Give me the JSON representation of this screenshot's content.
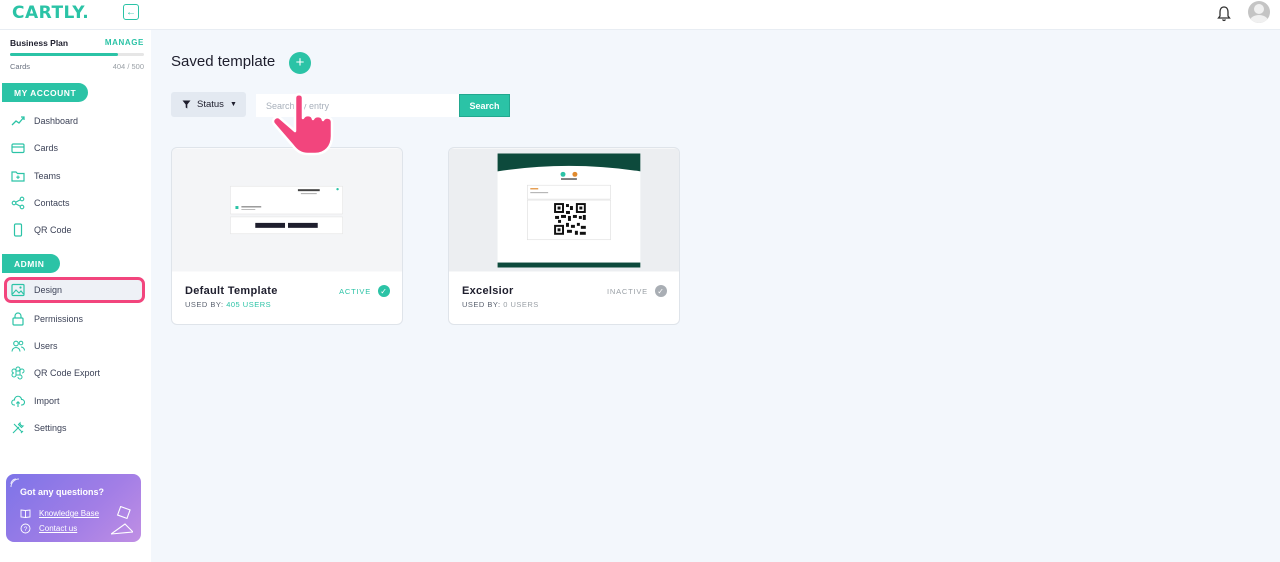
{
  "brand": {
    "logo_text": "CARTLY.",
    "accent": "#2bc3a6",
    "highlight": "#f2457d"
  },
  "plan": {
    "name": "Business Plan",
    "manage_label": "MANAGE",
    "cards_label": "Cards",
    "cards_count": "404 / 500",
    "usage_fraction": 0.808
  },
  "sidebar": {
    "my_account_label": "MY ACCOUNT",
    "admin_label": "ADMIN",
    "account_items": [
      {
        "label": "Dashboard",
        "icon": "trend-icon"
      },
      {
        "label": "Cards",
        "icon": "card-icon"
      },
      {
        "label": "Teams",
        "icon": "folder-icon"
      },
      {
        "label": "Contacts",
        "icon": "share-icon"
      },
      {
        "label": "QR Code",
        "icon": "phone-icon"
      }
    ],
    "admin_items": [
      {
        "label": "Design",
        "icon": "image-icon",
        "active": true
      },
      {
        "label": "Permissions",
        "icon": "lock-icon"
      },
      {
        "label": "Users",
        "icon": "users-icon"
      },
      {
        "label": "QR Code Export",
        "icon": "command-icon"
      },
      {
        "label": "Import",
        "icon": "cloud-upload-icon"
      },
      {
        "label": "Settings",
        "icon": "tools-icon"
      }
    ]
  },
  "help": {
    "title": "Got any questions?",
    "knowledge_base": "Knowledge Base",
    "contact_us": "Contact us"
  },
  "main": {
    "title": "Saved template",
    "add_label": "+",
    "status_filter_label": "Status",
    "search_placeholder": "Search by entry",
    "search_button": "Search",
    "templates": [
      {
        "name": "Default Template",
        "used_prefix": "USED BY:",
        "used_count": "405 USERS",
        "status": "ACTIVE",
        "status_color": "#2bc3a6"
      },
      {
        "name": "Excelsior",
        "used_prefix": "USED BY:",
        "used_count": "0 USERS",
        "status": "INACTIVE",
        "status_color": "#9aa0a6"
      }
    ]
  }
}
